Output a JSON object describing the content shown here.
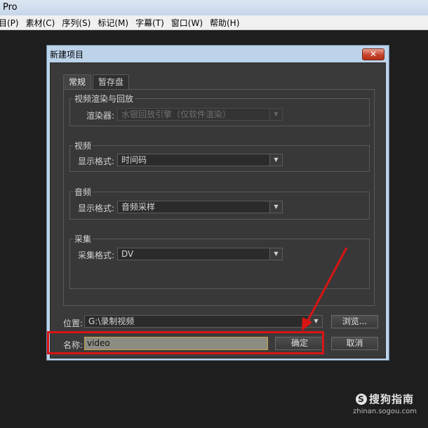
{
  "app": {
    "title": "Pro"
  },
  "menu": [
    "目(P)",
    "素材(C)",
    "序列(S)",
    "标记(M)",
    "字幕(T)",
    "窗口(W)",
    "帮助(H)"
  ],
  "dialog": {
    "title": "新建项目",
    "close_glyph": "✕",
    "tabs": [
      "常规",
      "暂存盘"
    ],
    "groups": {
      "render": {
        "legend": "视频渲染与回放",
        "label": "渲染器:",
        "value": "水银回放引擎（仅软件渲染）"
      },
      "video": {
        "legend": "视频",
        "label": "显示格式:",
        "value": "时间码"
      },
      "audio": {
        "legend": "音频",
        "label": "显示格式:",
        "value": "音频采样"
      },
      "capture": {
        "legend": "采集",
        "label": "采集格式:",
        "value": "DV"
      }
    },
    "location": {
      "label": "位置:",
      "value": "G:\\录制视频",
      "browse_label": "浏览..."
    },
    "name": {
      "label": "名称:",
      "value": "video"
    },
    "ok_label": "确定",
    "cancel_label": "取消"
  },
  "watermark": {
    "brand": "搜狗指南",
    "url": "zhinan.sogou.com"
  },
  "colors": {
    "annotation": "#d81414",
    "dialog_bg": "#3a3a3a"
  }
}
